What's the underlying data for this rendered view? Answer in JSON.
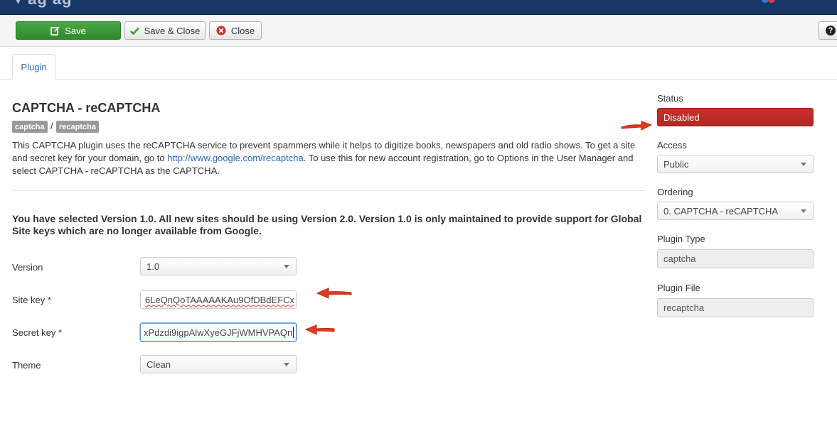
{
  "toolbar": {
    "save_label": "Save",
    "save_close_label": "Save & Close",
    "close_label": "Close",
    "help_icon": "?"
  },
  "tabs": [
    {
      "label": "Plugin"
    }
  ],
  "plugin": {
    "title": "CAPTCHA - reCAPTCHA",
    "tags": [
      "captcha",
      "recaptcha"
    ],
    "tag_separator": "/",
    "description_part1": "This CAPTCHA plugin uses the reCAPTCHA service to prevent spammers while it helps to digitize books, newspapers and old radio shows. To get a site and secret key for your domain, go to ",
    "description_link": "http://www.google.com/recaptcha",
    "description_part2": ". To use this for new account registration, go to Options in the User Manager and select CAPTCHA - reCAPTCHA as the CAPTCHA.",
    "version_warning": "You have selected Version 1.0. All new sites should be using Version 2.0. Version 1.0 is only maintained to provide support for Global Site keys which are no longer available from Google."
  },
  "fields": {
    "version": {
      "label": "Version",
      "value": "1.0"
    },
    "site_key": {
      "label": "Site key *",
      "value": "6LeQnQoTAAAAAKAu9OfDBdEFCx"
    },
    "secret_key": {
      "label": "Secret key *",
      "value": "хPdzdi9igpAlwXyeGJFjWMHVPAQn"
    },
    "theme": {
      "label": "Theme",
      "value": "Clean"
    }
  },
  "sidebar": {
    "status": {
      "label": "Status",
      "value": "Disabled"
    },
    "access": {
      "label": "Access",
      "value": "Public"
    },
    "ordering": {
      "label": "Ordering",
      "value": "0. CAPTCHA - reCAPTCHA"
    },
    "plugin_type": {
      "label": "Plugin Type",
      "value": "captcha"
    },
    "plugin_file": {
      "label": "Plugin File",
      "value": "recaptcha"
    }
  },
  "colors": {
    "save_green": "#3a9a37",
    "status_red": "#c9302c",
    "link_blue": "#2a69b8",
    "annotation_arrow": "#e23a1f",
    "topbar": "#1a3867"
  }
}
